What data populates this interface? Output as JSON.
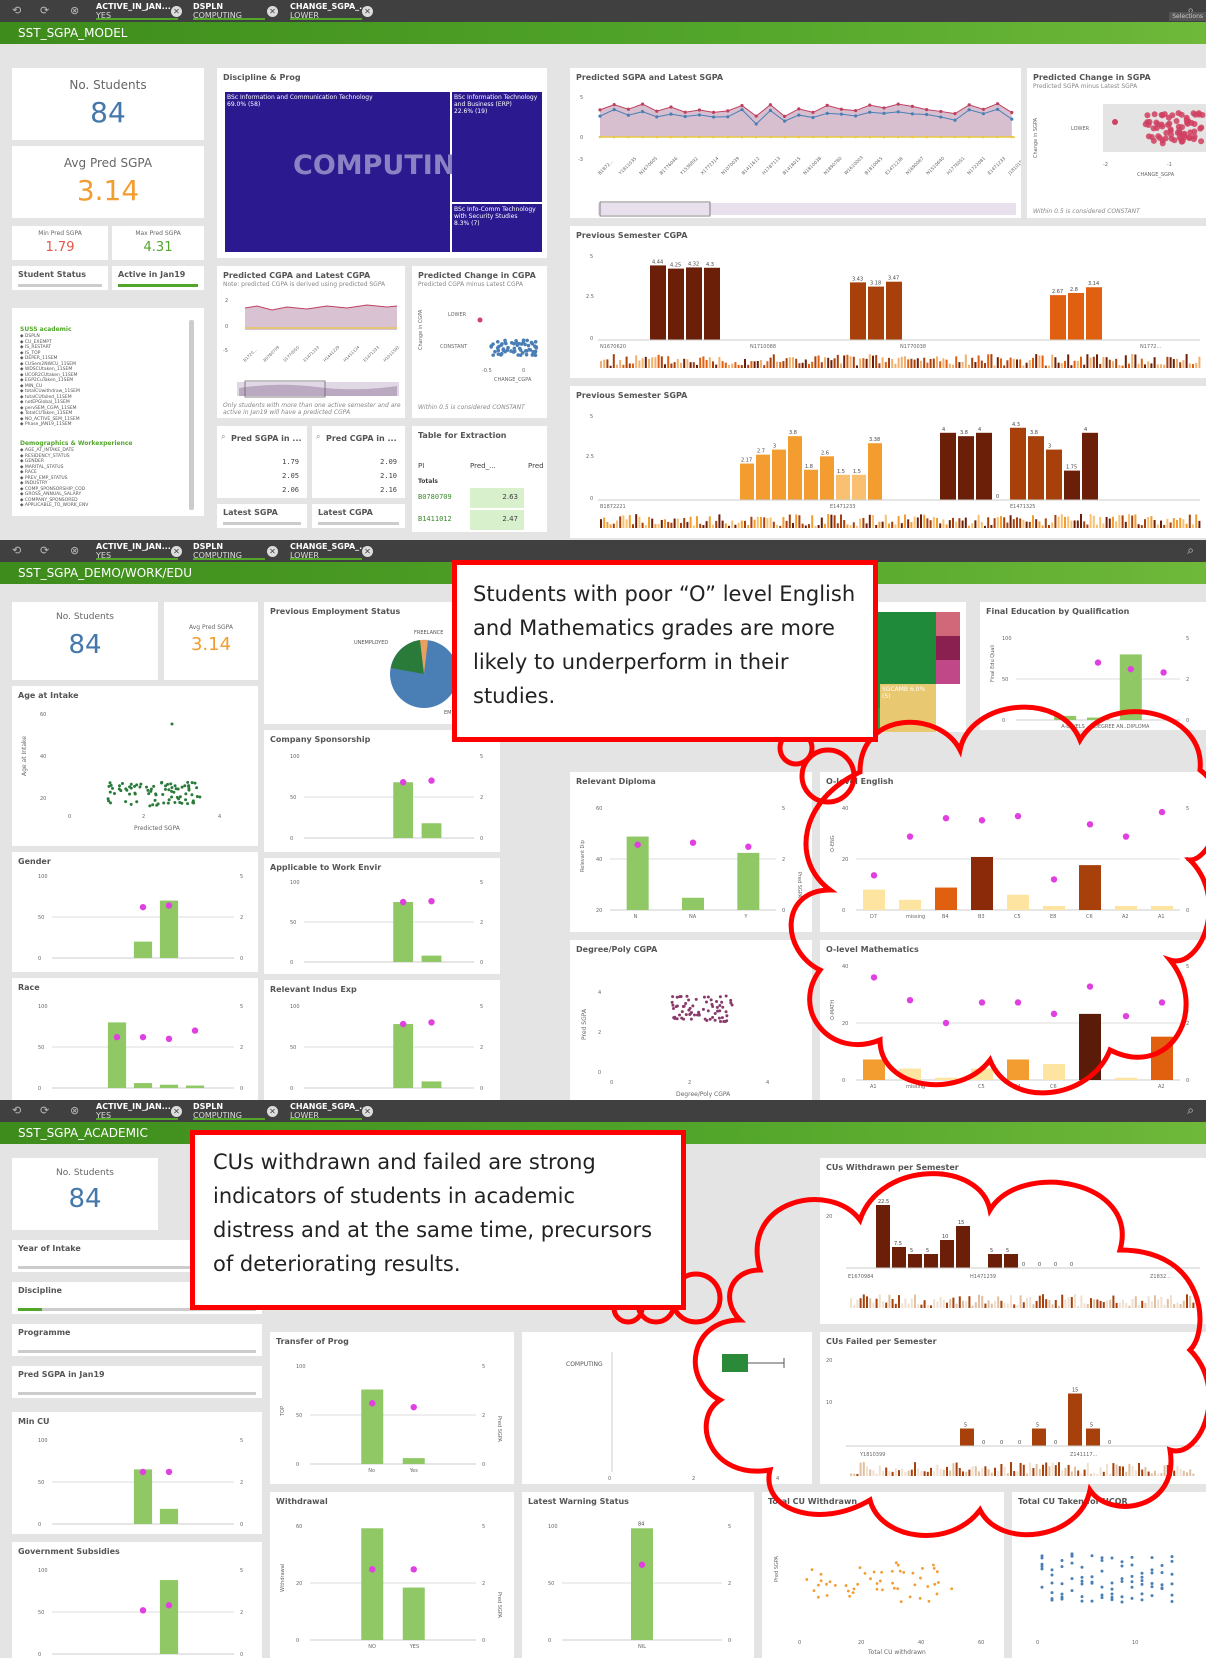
{
  "toolbar": {
    "filters": [
      {
        "field": "ACTIVE_IN_JAN...",
        "value": "YES"
      },
      {
        "field": "DSPLN",
        "value": "COMPUTING"
      },
      {
        "field": "CHANGE_SGPA_...",
        "value": "LOWER"
      }
    ],
    "selections_label": "Selections"
  },
  "model": {
    "sheet_title": "SST_SGPA_MODEL",
    "kpi_students": {
      "label": "No. Students",
      "value": "84"
    },
    "kpi_avg": {
      "label": "Avg Pred SGPA",
      "value": "3.14"
    },
    "kpi_min": {
      "label": "Min Pred SGPA",
      "value": "1.79"
    },
    "kpi_max": {
      "label": "Max Pred SGPA",
      "value": "4.31"
    },
    "filter_status": "Student Status",
    "filter_active": "Active in Jan19",
    "field_list_title": "SUSS academic",
    "field_list": [
      "DSPLN",
      "CU_EXEMPT",
      "IS_RESTART",
      "IS_TOP",
      "DEPER_11SEM",
      "CUSem2NWCU_11SEM",
      "WDSCUtaken_11SEM",
      "UCOR2CUtaken_11SEM",
      "EGP2CuTaken_11SEM",
      "MIN_CU",
      "totalCUwithdraw_11SEM",
      "totalCUfailed_11SEM",
      "notEPGlobal_11SEM",
      "pervSEM_CGPA_11SEM",
      "TotalCUTaken_11SEM",
      "NO_ACTIVE_SEM_11SEM",
      "Phase_JAN19_11SEM"
    ],
    "field_list_title2": "Demographics & Workexperience",
    "field_list2": [
      "AGE_AT_INTAKE_DATE",
      "RESIDENCY_STATUS",
      "GENDER",
      "MARITAL_STATUS",
      "RACE",
      "PREV_EMP_STATUS",
      "INDUSTRY",
      "COMP_SPONSORSHIP_COD",
      "GROSS_ANNUAL_SALARY",
      "COMPANY_SPONSORED",
      "APPLICABLE_TO_WORK_ENV"
    ],
    "discipline": {
      "title": "Discipline & Prog",
      "main_label": "COMPUTING",
      "blocks": [
        {
          "name": "BSc Information and Communication Technology",
          "pct": "69.0% (58)"
        },
        {
          "name": "BSc Information Technology and Business (ERP)",
          "pct": "22.6% (19)"
        },
        {
          "name": "BSc Info-Comm Technology with Security Studies",
          "pct": "8.3% (7)"
        }
      ]
    },
    "pred_sgpa_chart": {
      "title": "Predicted SGPA and Latest SGPA",
      "y_ticks": [
        "5",
        "0",
        "-3"
      ],
      "x_labels": [
        "B1872...",
        "Y1811035",
        "N1670605",
        "B1776046",
        "Y1536892",
        "X1772314",
        "N1070039",
        "B1411612",
        "H1787113",
        "B1418015",
        "N1810038",
        "N1890780",
        "W1610003",
        "B1810065",
        "E1471238",
        "N1690067",
        "N1510640",
        "H1776051",
        "N1722081",
        "E1471233",
        "J1810155"
      ]
    },
    "pred_change_sgpa": {
      "title": "Predicted Change in SGPA",
      "subtitle": "Predicted SGPA minus Latest SGPA",
      "y_label": "Change in SGPA",
      "cat": "LOWER",
      "x_ticks": [
        "-2",
        "-1"
      ],
      "x_label": "CHANGE_SGPA",
      "note": "Within 0.5 is considered CONSTANT"
    },
    "pred_cgpa_chart": {
      "title": "Predicted CGPA and Latest CGPA",
      "subtitle": "Note: predicted CGPA is derived using predicted SGPA",
      "y_ticks": [
        "2",
        "0",
        "-5"
      ],
      "x_labels": [
        "B1720...",
        "B0780709",
        "S1770050",
        "E1471233",
        "H1441229",
        "H1411124",
        "E1471233",
        "H1011592"
      ],
      "note": "Only students with more than one active semester and are active in Jan19 will have a predicted CGPA"
    },
    "pred_change_cgpa": {
      "title": "Predicted Change in CGPA",
      "subtitle": "Predicted CGPA minus Latest CGPA",
      "y_label": "Change in CGPA",
      "cats": [
        "LOWER",
        "CONSTANT"
      ],
      "x_ticks": [
        "-0.5",
        "0"
      ],
      "x_label": "CHANGE_CGPA",
      "note": "Within 0.5 is considered CONSTANT"
    },
    "prev_cgpa": {
      "title": "Previous Semester CGPA",
      "y_ticks": [
        "5",
        "2.5",
        "0"
      ],
      "x_labels": [
        "N1670620",
        "N1710088",
        "N1770038",
        "N1772..."
      ],
      "labels": [
        "4.44",
        "4.25",
        "4.32",
        "4.3",
        "3.43",
        "3.18",
        "3.47",
        "2.67",
        "2.8",
        "3.14"
      ]
    },
    "prev_sgpa": {
      "title": "Previous Semester SGPA",
      "y_ticks": [
        "5",
        "2.5",
        "0"
      ],
      "x_labels": [
        "B1872221",
        "E1471233",
        "E1471325"
      ],
      "labels": [
        "2.17",
        "2.7",
        "3",
        "3.8",
        "1.8",
        "2.6",
        "1.5",
        "1.5",
        "3.38",
        "4",
        "3.8",
        "4",
        "0",
        "4.3",
        "3.8",
        "3",
        "1.75",
        "4"
      ]
    },
    "pred_sgpa_table": {
      "title": "Pred SGPA in ...",
      "rows": [
        "1.79",
        "2.05",
        "2.06"
      ]
    },
    "pred_cgpa_table": {
      "title": "Pred CGPA in ...",
      "rows": [
        "2.09",
        "2.10",
        "2.16"
      ]
    },
    "extraction": {
      "title": "Table for Extraction",
      "cols": [
        "PI",
        "Pred_...",
        "Pred"
      ],
      "totals_label": "Totals",
      "rows": [
        [
          "B0780709",
          "2.63"
        ],
        [
          "B1411012",
          "2.47"
        ]
      ]
    },
    "latest_sgpa": "Latest SGPA",
    "latest_cgpa": "Latest CGPA"
  },
  "demo": {
    "sheet_title": "SST_SGPA_DEMO/WORK/EDU",
    "kpi_students": {
      "label": "No. Students",
      "value": "84"
    },
    "kpi_avg": {
      "label": "Avg Pred SGPA",
      "value": "3.14"
    },
    "age": {
      "title": "Age at Intake",
      "y_label": "Age at Intake",
      "y_ticks": [
        "60",
        "40",
        "20"
      ],
      "x_ticks": [
        "0",
        "2",
        "4"
      ],
      "x_label": "Predicted SGPA"
    },
    "prev_emp": {
      "title": "Previous Employment Status",
      "labels": [
        "FREELANCE",
        "UNEMPLOYED",
        "EMPLOYED"
      ]
    },
    "company": {
      "title": "Company Sponsorship"
    },
    "gender": {
      "title": "Gender"
    },
    "applicable": {
      "title": "Applicable to Work Envir"
    },
    "race": {
      "title": "Race"
    },
    "indus": {
      "title": "Relevant Indus Exp"
    },
    "treemap_label": "SGCAMB 6.0% (5)",
    "final_edu": {
      "title": "Final Education by Qualification",
      "y_label": "Final Edu Quali",
      "x_labels": [
        "A-LEVELS",
        "DEGREE AN...",
        "DIPLOMA"
      ]
    },
    "diploma": {
      "title": "Relevant Diploma",
      "y_label": "Relevant Dip",
      "y2_label": "Pred SGPA",
      "y_ticks": [
        "60",
        "40",
        "20",
        "0"
      ],
      "x_labels": [
        "N",
        "NA",
        "Y"
      ]
    },
    "olevel_eng": {
      "title": "O-level English",
      "y_label": "O-ENG",
      "x_labels": [
        "D7",
        "missing",
        "B4",
        "B3",
        "C5",
        "E8",
        "C6",
        "A2",
        "A1"
      ]
    },
    "degree_cgpa": {
      "title": "Degree/Poly CGPA",
      "y_label": "Pred SGPA",
      "x_label": "Degree/Poly CGPA",
      "x_ticks": [
        "0",
        "2",
        "4"
      ],
      "y_ticks": [
        "4",
        "2",
        "0"
      ]
    },
    "olevel_math": {
      "title": "O-level Mathematics",
      "y_label": "O-MATH",
      "x_labels": [
        "A1",
        "missing",
        "C5",
        "B4",
        "C6",
        "A2"
      ]
    },
    "callout": "Students with poor “O” level English and Mathematics grades are more likely to underperform in their studies."
  },
  "academic": {
    "sheet_title": "SST_SGPA_ACADEMIC",
    "kpi_students": {
      "label": "No. Students",
      "value": "84"
    },
    "filters": [
      "Year of Intake",
      "Discipline",
      "Programme",
      "Pred SGPA in Jan19"
    ],
    "min_cu": {
      "title": "Min CU"
    },
    "gov": {
      "title": "Government Subsidies"
    },
    "transfer": {
      "title": "Transfer of Prog",
      "y_label": "TOP",
      "y2_label": "Pred SGPA",
      "x_labels": [
        "No",
        "Yes"
      ]
    },
    "withdrawal": {
      "title": "Withdrawal",
      "y_label": "Withdrawal",
      "y2_label": "Pred SGPA",
      "x_labels": [
        "NO",
        "YES"
      ]
    },
    "warning": {
      "title": "Latest Warning Status",
      "bar_label": "84",
      "x_labels": [
        "NIL"
      ]
    },
    "box_label": "COMPUTING",
    "cu_withdrawn": {
      "title": "CUs Withdrawn per Semester",
      "x_labels": [
        "E1670984",
        "H1471239",
        "Z1832..."
      ],
      "labels": [
        "22.5",
        "7.5",
        "5",
        "5",
        "10",
        "15",
        "5",
        "5",
        "0",
        "0",
        "0",
        "0"
      ]
    },
    "cu_failed": {
      "title": "CUs Failed per Semester",
      "x_labels": [
        "Y1810399",
        "Z141117..."
      ],
      "labels": [
        "5",
        "0",
        "0",
        "0",
        "5",
        "0",
        "15",
        "5",
        "0"
      ]
    },
    "total_cu": {
      "title": "Total CU Withdrawn",
      "y_label": "Pred SGPA",
      "x_label": "Total CU withdrawn",
      "x_ticks": [
        "0",
        "20",
        "40",
        "60"
      ]
    },
    "total_ucor": {
      "title": "Total CU Taken for UCOR",
      "x_ticks": [
        "0",
        "10"
      ]
    },
    "callout": "CUs withdrawn and failed are strong indicators of students in academic distress and at the same time, precursors of deteriorating results."
  }
}
